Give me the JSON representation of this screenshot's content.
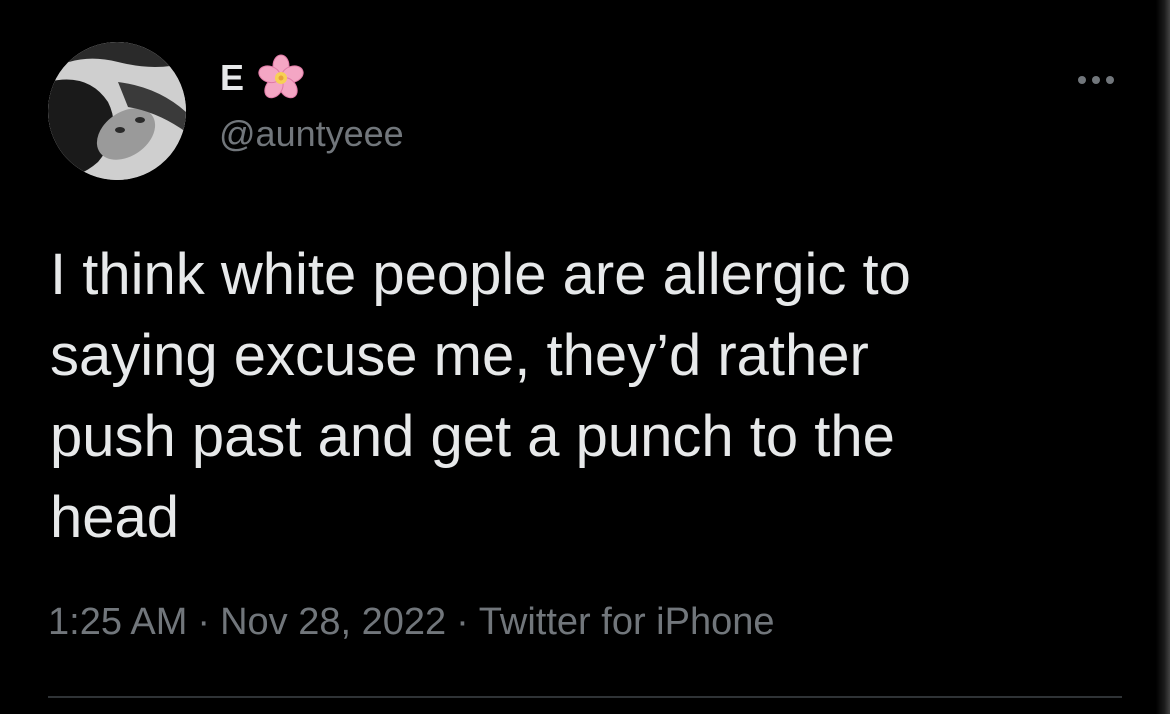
{
  "tweet": {
    "display_name": "E",
    "name_emoji_icon": "cherry-blossom-icon",
    "handle": "@auntyeee",
    "text_lines": [
      "I think white people are allergic to",
      "saying excuse me, they’d rather",
      "push past and get a punch to the",
      "head"
    ],
    "time": "1:25 AM",
    "date": "Nov 28, 2022",
    "source": "Twitter for iPhone",
    "separator": "·",
    "more_icon": "ellipsis-icon"
  },
  "colors": {
    "background": "#000000",
    "primary_text": "#e7e9ea",
    "secondary_text": "#71767b",
    "divider": "#2f3336",
    "flower_pink": "#f4a6c4",
    "flower_center": "#f7d154"
  }
}
